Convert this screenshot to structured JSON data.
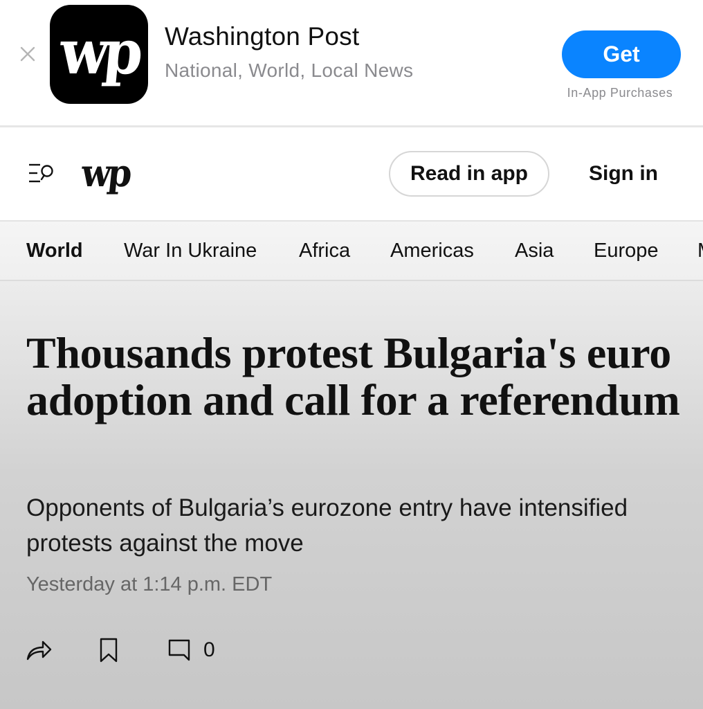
{
  "banner": {
    "app_icon_text": "wp",
    "app_name": "Washington Post",
    "app_subtitle": "National, World, Local News",
    "get_label": "Get",
    "iap_note": "In-App Purchases",
    "accent_color": "#0a84ff"
  },
  "header": {
    "logo_text": "wp",
    "read_in_app_label": "Read in app",
    "sign_in_label": "Sign in",
    "menu_icon": "menu-search-icon"
  },
  "nav": {
    "items": [
      {
        "label": "World",
        "active": true
      },
      {
        "label": "War In Ukraine",
        "active": false
      },
      {
        "label": "Africa",
        "active": false
      },
      {
        "label": "Americas",
        "active": false
      },
      {
        "label": "Asia",
        "active": false
      },
      {
        "label": "Europe",
        "active": false
      },
      {
        "label": "M",
        "active": false
      }
    ]
  },
  "article": {
    "headline": "Thousands protest Bulgaria's euro adoption and call for a referendum",
    "dek": "Opponents of Bulgaria’s eurozone entry have intensified protests against the move",
    "timestamp": "Yesterday at 1:14 p.m. EDT",
    "comment_count": "0",
    "actions": [
      "share-icon",
      "bookmark-icon",
      "comment-icon"
    ]
  }
}
